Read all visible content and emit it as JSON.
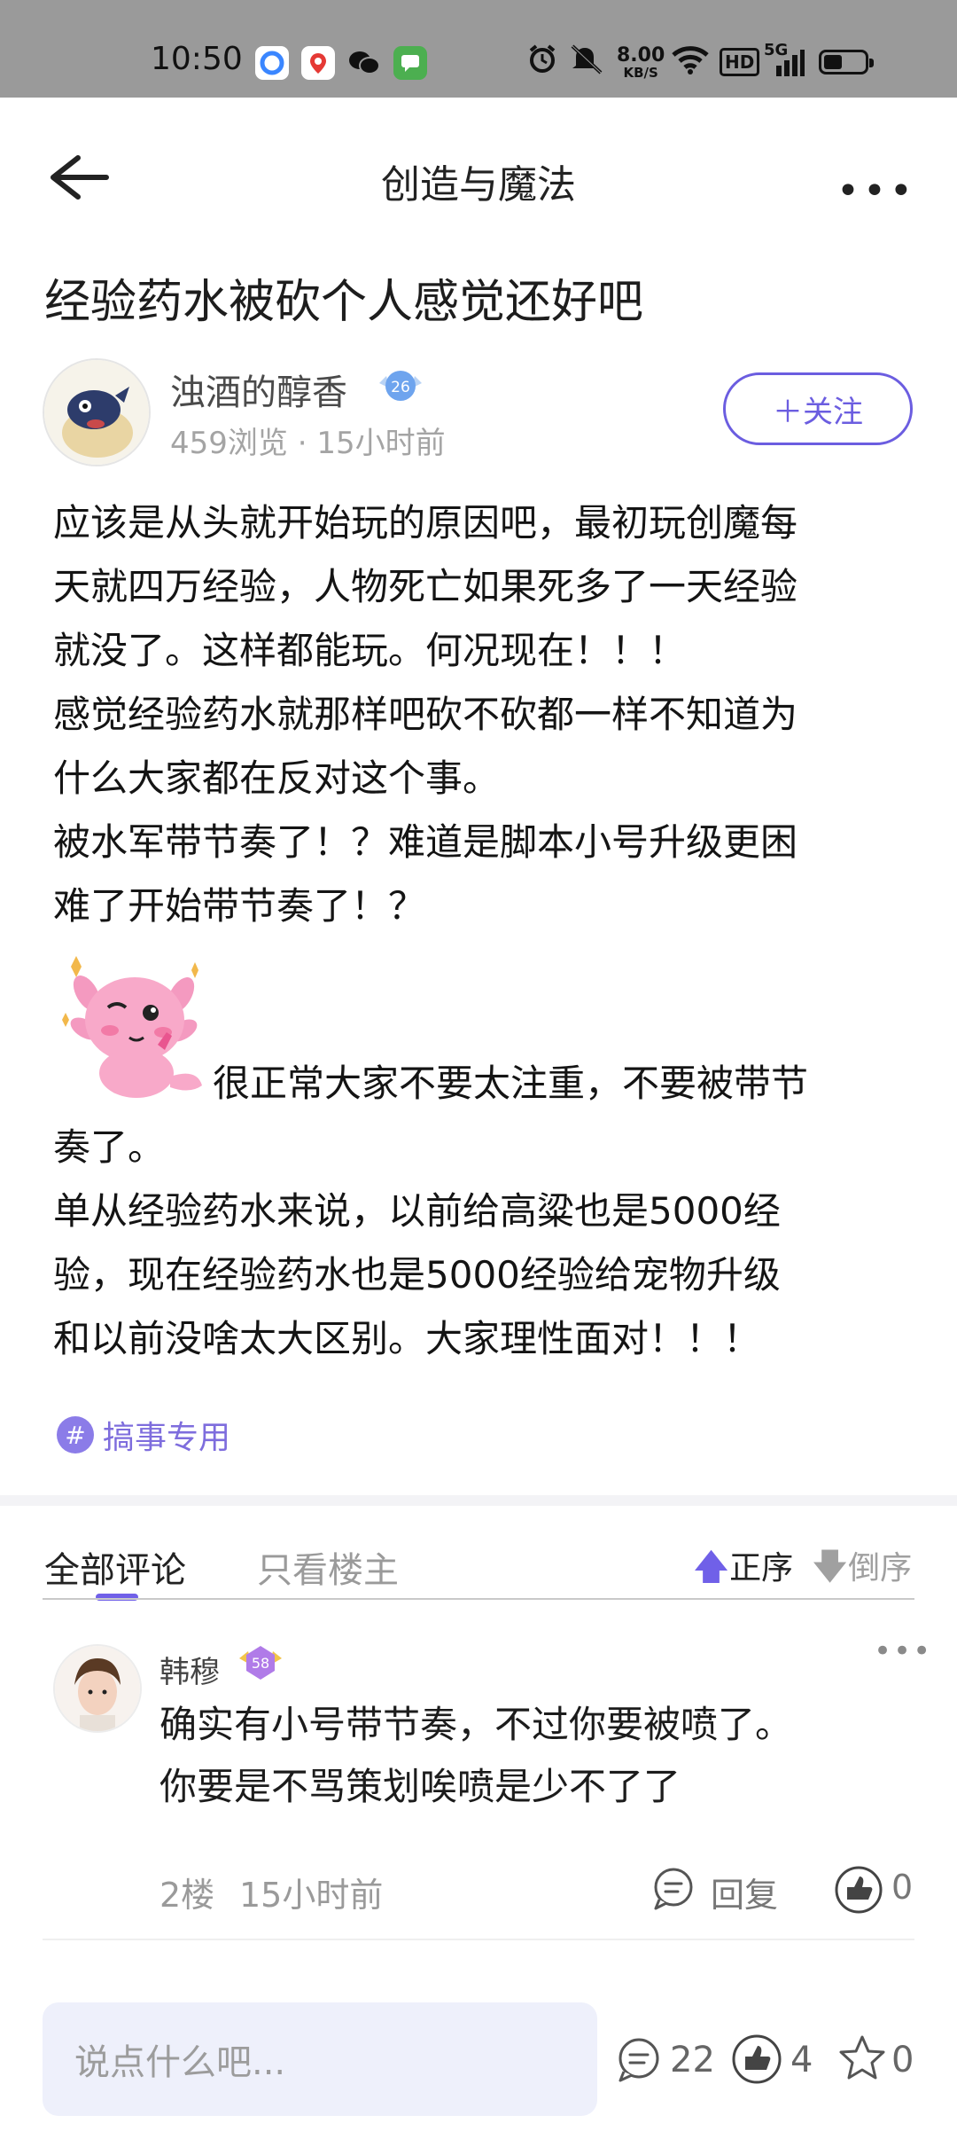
{
  "status_bar": {
    "time": "10:50",
    "net_speed_value": "8.00",
    "net_speed_unit": "KB/S",
    "hd": "HD",
    "network": "5G",
    "battery_level": 0.45
  },
  "header": {
    "title": "创造与魔法",
    "more": "•••"
  },
  "post": {
    "title": "经验药水被砍个人感觉还好吧",
    "author": "浊酒的醇香",
    "author_level": "26",
    "meta": "459浏览 · 15小时前",
    "follow_label": "＋关注",
    "paragraphs_top": [
      "应该是从头就开始玩的原因吧，最初玩创魔每",
      "天就四万经验，人物死亡如果死多了一天经验",
      "就没了。这样都能玩。何况现在！！！",
      "感觉经验药水就那样吧砍不砍都一样不知道为",
      "什么大家都在反对这个事。",
      "被水军带节奏了！？难道是脚本小号升级更困",
      "难了开始带节奏了！？"
    ],
    "after_sticker_line": "很正常大家不要太注重，不要被带节",
    "paragraphs_bottom": [
      "奏了。",
      "单从经验药水来说，以前给高粱也是5000经",
      "验，现在经验药水也是5000经验给宠物升级",
      "和以前没啥太大区别。大家理性面对！！！"
    ],
    "tag": "搞事专用"
  },
  "comments_section": {
    "tabs": [
      "全部评论",
      "只看楼主"
    ],
    "sort_asc": "正序",
    "sort_desc": "倒序"
  },
  "comment": {
    "name": "韩穆",
    "level": "58",
    "more": "•••",
    "lines": [
      "确实有小号带节奏，不过你要被喷了。",
      "你要是不骂策划唉喷是少不了了"
    ],
    "floor": "2楼",
    "time": "15小时前",
    "reply_label": "回复",
    "likes": "0"
  },
  "bottom_bar": {
    "input_placeholder": "说点什么吧...",
    "comments_count": "22",
    "likes_count": "4",
    "favorites_count": "0"
  }
}
